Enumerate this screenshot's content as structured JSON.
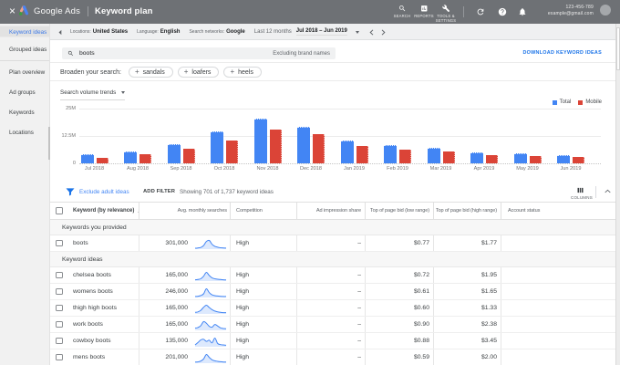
{
  "topbar": {
    "close_label": "×",
    "product": "Google Ads",
    "page": "Keyword plan",
    "nav_items": [
      {
        "id": "search",
        "label": "SEARCH"
      },
      {
        "id": "reports",
        "label": "REPORTS"
      },
      {
        "id": "tools",
        "label": "TOOLS & SETTINGS"
      }
    ],
    "account_id": "123-456-789",
    "account_email": "example@gmail.com"
  },
  "sidebar": {
    "selected": "Keyword ideas",
    "group1": [
      "Keyword ideas",
      "Grouped ideas"
    ],
    "group2": [
      "Plan overview",
      "Ad groups",
      "Keywords",
      "Locations"
    ]
  },
  "toolbar": {
    "filters": [
      {
        "label": "Locations:",
        "value": "United States"
      },
      {
        "label": "Language:",
        "value": "English"
      },
      {
        "label": "Search networks:",
        "value": "Google"
      }
    ],
    "date_label": "Last 12 months",
    "date_range": "Jul 2018 – Jun 2019"
  },
  "search": {
    "query": "boots",
    "exclusion": "Excluding brand names",
    "download_label": "DOWNLOAD KEYWORD IDEAS"
  },
  "broaden": {
    "label": "Broaden your search:",
    "chips": [
      "sandals",
      "loafers",
      "heels"
    ]
  },
  "chart_data": {
    "type": "bar",
    "title": "Search volume trends",
    "categories": [
      "Jul 2018",
      "Aug 2018",
      "Sep 2018",
      "Oct 2018",
      "Nov 2018",
      "Dec 2018",
      "Jan 2019",
      "Feb 2019",
      "Mar 2019",
      "Apr 2019",
      "May 2019",
      "Jun 2019"
    ],
    "series": [
      {
        "name": "Total",
        "color": "#4285f4",
        "values": [
          4.0,
          5.5,
          8.8,
          14.6,
          20.5,
          16.6,
          10.4,
          8.4,
          7.2,
          4.9,
          4.6,
          3.8
        ]
      },
      {
        "name": "Mobile",
        "color": "#db4437",
        "values": [
          2.7,
          4.0,
          6.5,
          10.6,
          15.5,
          13.2,
          7.9,
          6.3,
          5.4,
          3.6,
          3.4,
          2.8
        ]
      }
    ],
    "unit": "M",
    "ylim": [
      0,
      25
    ],
    "yticks": [
      "25M",
      "12.5M",
      "0"
    ],
    "legend_position": "top-right"
  },
  "filter_bar": {
    "exclude_link": "Exclude adult ideas",
    "add_filter": "ADD FILTER",
    "showing": "Showing 701 of 1,737 keyword ideas",
    "columns_label": "COLUMNS"
  },
  "table": {
    "columns": [
      "",
      "Keyword (by relevance)",
      "Avg. monthly searches",
      "Competition",
      "Ad impression share",
      "Top of page bid (low range)",
      "Top of page bid (high range)",
      "Account status"
    ],
    "sort_column": "Keyword (by relevance)",
    "sections": [
      {
        "title": "Keywords you provided",
        "rows": [
          {
            "keyword": "boots",
            "searches": "301,000",
            "spark": [
              7,
              9,
              13,
              28,
              60,
              68,
              38,
              22,
              15,
              11,
              9,
              8
            ],
            "competition": "High",
            "ad_share": "–",
            "bid_low": "$0.77",
            "bid_high": "$1.77",
            "account_status": ""
          }
        ]
      },
      {
        "title": "Keyword ideas",
        "rows": [
          {
            "keyword": "chelsea boots",
            "searches": "165,000",
            "spark": [
              10,
              12,
              18,
              38,
              68,
              44,
              26,
              18,
              14,
              12,
              10,
              9
            ],
            "competition": "High",
            "ad_share": "–",
            "bid_low": "$0.72",
            "bid_high": "$1.95",
            "account_status": ""
          },
          {
            "keyword": "womens boots",
            "searches": "246,000",
            "spark": [
              8,
              10,
              16,
              30,
              72,
              40,
              22,
              15,
              12,
              10,
              8,
              8
            ],
            "competition": "High",
            "ad_share": "–",
            "bid_low": "$0.61",
            "bid_high": "$1.65",
            "account_status": ""
          },
          {
            "keyword": "thigh high boots",
            "searches": "165,000",
            "spark": [
              12,
              16,
              28,
              52,
              68,
              50,
              34,
              22,
              16,
              12,
              10,
              10
            ],
            "competition": "High",
            "ad_share": "–",
            "bid_low": "$0.60",
            "bid_high": "$1.33",
            "account_status": ""
          },
          {
            "keyword": "work boots",
            "searches": "165,000",
            "spark": [
              14,
              18,
              30,
              56,
              46,
              26,
              20,
              38,
              28,
              16,
              12,
              10
            ],
            "competition": "High",
            "ad_share": "–",
            "bid_low": "$0.90",
            "bid_high": "$2.38",
            "account_status": ""
          },
          {
            "keyword": "cowboy boots",
            "searches": "135,000",
            "spark": [
              12,
              28,
              46,
              50,
              36,
              44,
              26,
              58,
              22,
              14,
              12,
              10
            ],
            "competition": "High",
            "ad_share": "–",
            "bid_low": "$0.88",
            "bid_high": "$3.45",
            "account_status": ""
          },
          {
            "keyword": "mens boots",
            "searches": "201,000",
            "spark": [
              8,
              10,
              16,
              32,
              66,
              44,
              26,
              18,
              14,
              11,
              9,
              8
            ],
            "competition": "High",
            "ad_share": "–",
            "bid_low": "$0.59",
            "bid_high": "$2.00",
            "account_status": ""
          }
        ]
      }
    ]
  },
  "colors": {
    "topbar_bg": "#6e7175",
    "accent_blue": "#1a73e8",
    "link_blue": "#4285f4",
    "bar_total": "#4285f4",
    "bar_mobile": "#db4437",
    "sidebar_selected": "#3b78e7"
  }
}
